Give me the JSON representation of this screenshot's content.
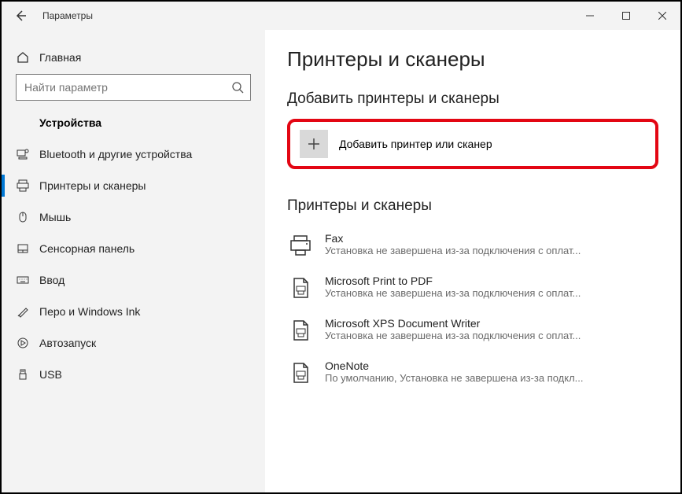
{
  "titlebar": {
    "title": "Параметры"
  },
  "sidebar": {
    "home": "Главная",
    "search_placeholder": "Найти параметр",
    "section": "Устройства",
    "items": [
      {
        "label": "Bluetooth и другие устройства"
      },
      {
        "label": "Принтеры и сканеры"
      },
      {
        "label": "Мышь"
      },
      {
        "label": "Сенсорная панель"
      },
      {
        "label": "Ввод"
      },
      {
        "label": "Перо и Windows Ink"
      },
      {
        "label": "Автозапуск"
      },
      {
        "label": "USB"
      }
    ]
  },
  "content": {
    "title": "Принтеры и сканеры",
    "add_section": "Добавить принтеры и сканеры",
    "add_button": "Добавить принтер или сканер",
    "list_section": "Принтеры и сканеры",
    "printers": [
      {
        "name": "Fax",
        "status": "Установка не завершена из-за подключения с оплат..."
      },
      {
        "name": "Microsoft Print to PDF",
        "status": "Установка не завершена из-за подключения с оплат..."
      },
      {
        "name": "Microsoft XPS Document Writer",
        "status": "Установка не завершена из-за подключения с оплат..."
      },
      {
        "name": "OneNote",
        "status": "По умолчанию, Установка не завершена из-за подкл..."
      }
    ]
  }
}
